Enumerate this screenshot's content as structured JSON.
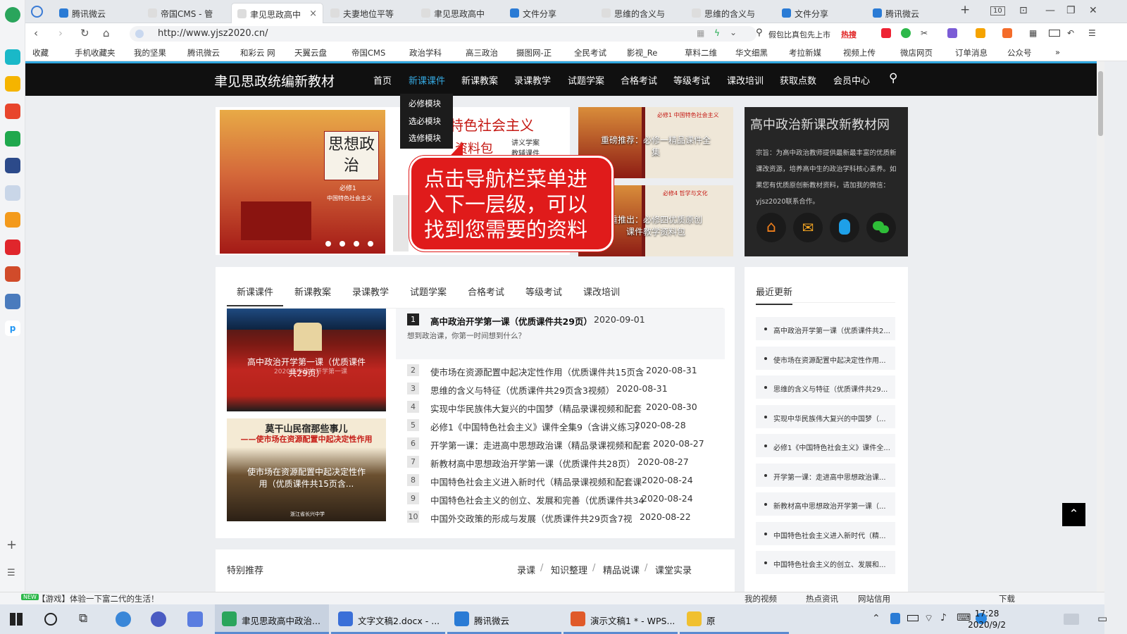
{
  "browser": {
    "tabs": [
      {
        "label": "腾讯微云",
        "active": false
      },
      {
        "label": "帝国CMS - 管",
        "active": false
      },
      {
        "label": "聿见思政高中",
        "active": true
      },
      {
        "label": "夫妻地位平等",
        "active": false
      },
      {
        "label": "聿见思政高中",
        "active": false
      },
      {
        "label": "文件分享",
        "active": false
      },
      {
        "label": "思维的含义与",
        "active": false
      },
      {
        "label": "思维的含义与",
        "active": false
      },
      {
        "label": "文件分享",
        "active": false
      },
      {
        "label": "腾讯微云",
        "active": false
      }
    ],
    "tab_count": "10",
    "new_tab": "+",
    "url": "http://www.yjsz2020.cn/",
    "search_placeholder": "假包比真包先上市",
    "hot_label": "热搜",
    "bookmarks": [
      "收藏",
      "手机收藏夹",
      "我的坚果",
      "腾讯微云",
      "和彩云 网",
      "天翼云盘",
      "帝国CMS",
      "政治学科",
      "高三政治",
      "摄图网-正",
      "全民考试",
      "影视_Re",
      "草料二维",
      "华文细黑",
      "考拉新媒",
      "视频上传",
      "微店网页",
      "订单消息",
      "公众号",
      "»"
    ]
  },
  "site": {
    "logo": "聿见思政统编新教材",
    "nav": [
      "首页",
      "新课课件",
      "新课教案",
      "录课教学",
      "试题学案",
      "合格考试",
      "等级考试",
      "课改培训",
      "获取点数",
      "会员中心"
    ],
    "dropdown": [
      "必修模块",
      "选必模块",
      "选修模块"
    ],
    "slider": {
      "book_title": "思想政治",
      "book_sub": "必修1",
      "book_series": "中国特色社会主义",
      "side_title": "国特色社会主义",
      "side_sub": "资料包",
      "side_items": [
        "讲义学案",
        "教辅课件"
      ]
    },
    "thumbs": [
      {
        "banner": "必修1 中国特色社会主义",
        "caption": "重磅推荐：必修一精品课件全集"
      },
      {
        "banner": "必修4 哲学与文化",
        "caption": "重推出：必修四优质原创课件教学资料包"
      }
    ],
    "about": {
      "title": "高中政治新课改新教材网",
      "text": "宗旨：为高中政治教师提供最新最丰富的优质新课改资源，培养高中生的政治学科核心素养。如果您有优质原创新教材资料，请加我的微信：yjsz2020联系合作。"
    },
    "tooltip": "点击导航栏菜单进入下一层级，可以找到您需要的资料",
    "main_tabs": [
      "新课课件",
      "新课教案",
      "录课教学",
      "试题学案",
      "合格考试",
      "等级考试",
      "课改培训"
    ],
    "feature_cards": [
      {
        "caption": "高中政治开学第一课（优质课件共29页）",
        "overlay": "2020高中政治开学第一课"
      },
      {
        "headline": "莫干山民宿那些事儿",
        "subheadline": "——使市场在资源配置中起决定性作用",
        "caption": "使市场在资源配置中起决定性作用（优质课件共15页含...",
        "footer": "浙江省长兴中学"
      }
    ],
    "featured_article": {
      "num": "1",
      "title": "高中政治开学第一课（优质课件共29页）",
      "date": "2020-09-01",
      "excerpt": "想到政治课，你第一时间想到什么？"
    },
    "articles": [
      {
        "num": "2",
        "title": "使市场在资源配置中起决定性作用（优质课件共15页含",
        "date": "2020-08-31"
      },
      {
        "num": "3",
        "title": "思维的含义与特征（优质课件共29页含3视频）",
        "date": "2020-08-31"
      },
      {
        "num": "4",
        "title": "实现中华民族伟大复兴的中国梦（精品录课视频和配套",
        "date": "2020-08-30"
      },
      {
        "num": "5",
        "title": "必修1《中国特色社会主义》课件全集9（含讲义练习）",
        "date": "2020-08-28"
      },
      {
        "num": "6",
        "title": "开学第一课：走进高中思想政治课（精品录课视频和配套",
        "date": "2020-08-27"
      },
      {
        "num": "7",
        "title": "新教材高中思想政治开学第一课（优质课件共28页）",
        "date": "2020-08-27"
      },
      {
        "num": "8",
        "title": "中国特色社会主义进入新时代（精品录课视频和配套课",
        "date": "2020-08-24"
      },
      {
        "num": "9",
        "title": "中国特色社会主义的创立、发展和完善（优质课件共34",
        "date": "2020-08-24"
      },
      {
        "num": "10",
        "title": "中国外交政策的形成与发展（优质课件共29页含7视",
        "date": "2020-08-22"
      }
    ],
    "recent_title": "最近更新",
    "recent": [
      "高中政治开学第一课（优质课件共2...",
      "使市场在资源配置中起决定性作用...",
      "思维的含义与特征（优质课件共29...",
      "实现中华民族伟大复兴的中国梦（...",
      "必修1《中国特色社会主义》课件全...",
      "开学第一课：走进高中思想政治课...",
      "新教材高中思想政治开学第一课（...",
      "中国特色社会主义进入新时代（精...",
      "中国特色社会主义的创立、发展和..."
    ],
    "special_title": "特别推荐",
    "special_tabs": [
      "录课",
      "知识整理",
      "精品说课",
      "课堂实录"
    ],
    "special_sep": "/"
  },
  "statusbar": {
    "badge": "NEW",
    "left": "【游戏】体验一下富二代的生活！",
    "right": [
      "我的视频",
      "热点资讯",
      "网站信用",
      "下载"
    ]
  },
  "taskbar": {
    "items": [
      "聿见思政高中政治...",
      "文字文稿2.docx - ...",
      "腾讯微云",
      "演示文稿1 * - WPS...",
      "原"
    ],
    "time": "17:28",
    "date": "2020/9/2"
  },
  "colors": {
    "accent": "#35a8e0",
    "header": "#101010",
    "tooltip": "#e01b1b",
    "wechat": "#2ebd38",
    "qq": "#1ea0e8",
    "home": "#f07f1b",
    "mail": "#f5a623"
  }
}
